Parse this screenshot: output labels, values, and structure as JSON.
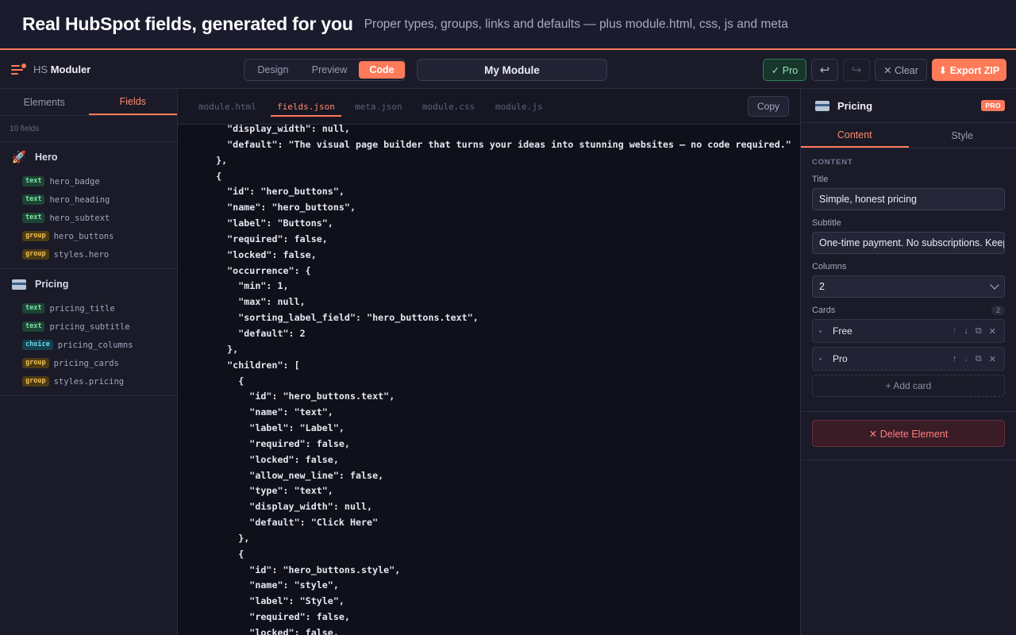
{
  "banner": {
    "title": "Real HubSpot fields, generated for you",
    "subtitle": "Proper types, groups, links and defaults — plus module.html, css, js and meta"
  },
  "topbar": {
    "brand_prefix": "HS",
    "brand_name": "Moduler",
    "modes": [
      "Design",
      "Preview",
      "Code"
    ],
    "active_mode": "Code",
    "module_name": "My Module",
    "pro_label": "✓ Pro",
    "undo_icon": "↩",
    "redo_icon": "↪",
    "clear_label": "✕ Clear",
    "export_label": "⬇ Export ZIP",
    "accent": "#ff7a59"
  },
  "left_panel": {
    "tabs": [
      "Elements",
      "Fields"
    ],
    "active_tab": "Fields",
    "field_count": "10 fields",
    "groups": [
      {
        "name": "Hero",
        "icon": "🚀",
        "fields": [
          {
            "type": "text",
            "name": "hero_badge"
          },
          {
            "type": "text",
            "name": "hero_heading"
          },
          {
            "type": "text",
            "name": "hero_subtext"
          },
          {
            "type": "group",
            "name": "hero_buttons"
          },
          {
            "type": "group",
            "name": "styles.hero"
          }
        ]
      },
      {
        "name": "Pricing",
        "icon": "credit-card-icon",
        "fields": [
          {
            "type": "text",
            "name": "pricing_title"
          },
          {
            "type": "text",
            "name": "pricing_subtitle"
          },
          {
            "type": "choice",
            "name": "pricing_columns"
          },
          {
            "type": "group",
            "name": "pricing_cards"
          },
          {
            "type": "group",
            "name": "styles.pricing"
          }
        ]
      }
    ]
  },
  "code_panel": {
    "tabs": [
      "module.html",
      "fields.json",
      "meta.json",
      "module.css",
      "module.js"
    ],
    "active_tab": "fields.json",
    "copy_label": "Copy",
    "lines": [
      "    \"display_width\": null,",
      "    \"default\": \"The visual page builder that turns your ideas into stunning websites — no code required.\"",
      "  },",
      "  {",
      "    \"id\": \"hero_buttons\",",
      "    \"name\": \"hero_buttons\",",
      "    \"label\": \"Buttons\",",
      "    \"required\": false,",
      "    \"locked\": false,",
      "    \"occurrence\": {",
      "      \"min\": 1,",
      "      \"max\": null,",
      "      \"sorting_label_field\": \"hero_buttons.text\",",
      "      \"default\": 2",
      "    },",
      "    \"children\": [",
      "      {",
      "        \"id\": \"hero_buttons.text\",",
      "        \"name\": \"text\",",
      "        \"label\": \"Label\",",
      "        \"required\": false,",
      "        \"locked\": false,",
      "        \"allow_new_line\": false,",
      "        \"type\": \"text\",",
      "        \"display_width\": null,",
      "        \"default\": \"Click Here\"",
      "      },",
      "      {",
      "        \"id\": \"hero_buttons.style\",",
      "        \"name\": \"style\",",
      "        \"label\": \"Style\",",
      "        \"required\": false,",
      "        \"locked\": false,"
    ]
  },
  "right_panel": {
    "element_name": "Pricing",
    "pro_badge": "PRO",
    "tabs": [
      "Content",
      "Style"
    ],
    "active_tab": "Content",
    "section_label": "CONTENT",
    "title_label": "Title",
    "title_value": "Simple, honest pricing",
    "subtitle_label": "Subtitle",
    "subtitle_value": "One-time payment. No subscriptions. Keep",
    "columns_label": "Columns",
    "columns_value": "2",
    "cards_label": "Cards",
    "cards_count": "2",
    "cards": [
      "Free",
      "Pro"
    ],
    "add_card_label": "+ Add card",
    "delete_label": "✕ Delete Element"
  }
}
